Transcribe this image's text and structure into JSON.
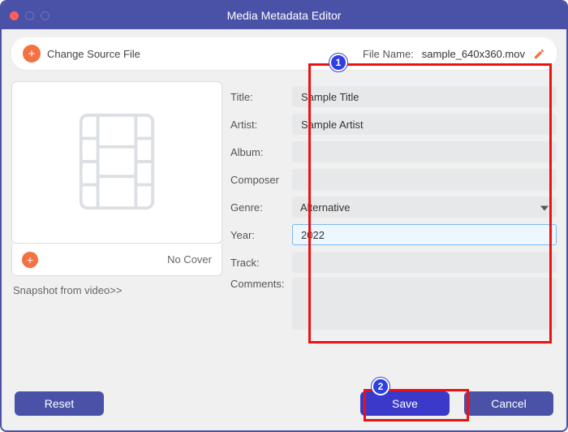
{
  "window": {
    "title": "Media Metadata Editor"
  },
  "topbar": {
    "change_source_label": "Change Source File",
    "file_label": "File Name:",
    "file_name": "sample_640x360.mov"
  },
  "cover": {
    "no_cover_label": "No Cover",
    "snapshot_link": "Snapshot from video>>"
  },
  "form": {
    "title_label": "Title:",
    "title_value": "Sample Title",
    "artist_label": "Artist:",
    "artist_value": "Sample Artist",
    "album_label": "Album:",
    "album_value": "",
    "composer_label": "Composer",
    "composer_value": "",
    "genre_label": "Genre:",
    "genre_value": "Alternative",
    "year_label": "Year:",
    "year_value": "2022",
    "track_label": "Track:",
    "track_value": "",
    "comments_label": "Comments:",
    "comments_value": ""
  },
  "buttons": {
    "reset": "Reset",
    "save": "Save",
    "cancel": "Cancel"
  },
  "annotations": {
    "one": "1",
    "two": "2"
  }
}
